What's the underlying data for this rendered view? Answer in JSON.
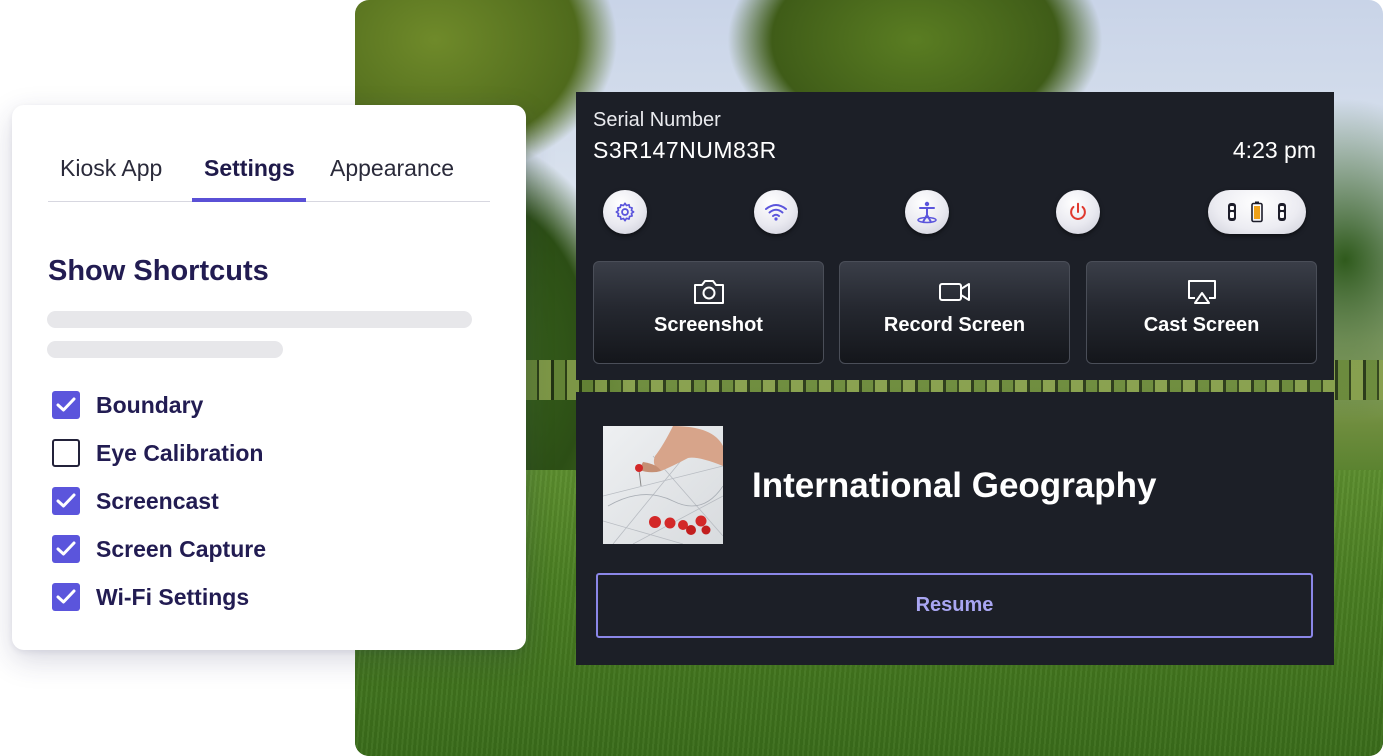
{
  "settings_card": {
    "tabs": [
      {
        "label": "Kiosk App",
        "active": false
      },
      {
        "label": "Settings",
        "active": true
      },
      {
        "label": "Appearance",
        "active": false
      }
    ],
    "section_title": "Show Shortcuts",
    "shortcuts": [
      {
        "label": "Boundary",
        "checked": true
      },
      {
        "label": "Eye Calibration",
        "checked": false
      },
      {
        "label": "Screencast",
        "checked": true
      },
      {
        "label": "Screen Capture",
        "checked": true
      },
      {
        "label": "Wi-Fi Settings",
        "checked": true
      }
    ]
  },
  "kiosk": {
    "serial_label": "Serial Number",
    "serial_value": "S3R147NUM83R",
    "time": "4:23 pm",
    "quick_icons": [
      "gear-icon",
      "wifi-icon",
      "boundary-icon",
      "power-icon",
      "battery-status-icon"
    ],
    "actions": [
      {
        "label": "Screenshot",
        "icon": "camera-icon"
      },
      {
        "label": "Record Screen",
        "icon": "video-camera-icon"
      },
      {
        "label": "Cast Screen",
        "icon": "cast-icon"
      }
    ],
    "course": {
      "title": "International Geography",
      "resume_label": "Resume"
    }
  },
  "colors": {
    "accent": "#5b55dc",
    "panel_bg": "#1c1f27",
    "resume_border": "#8a86e8",
    "heading": "#221c52"
  }
}
